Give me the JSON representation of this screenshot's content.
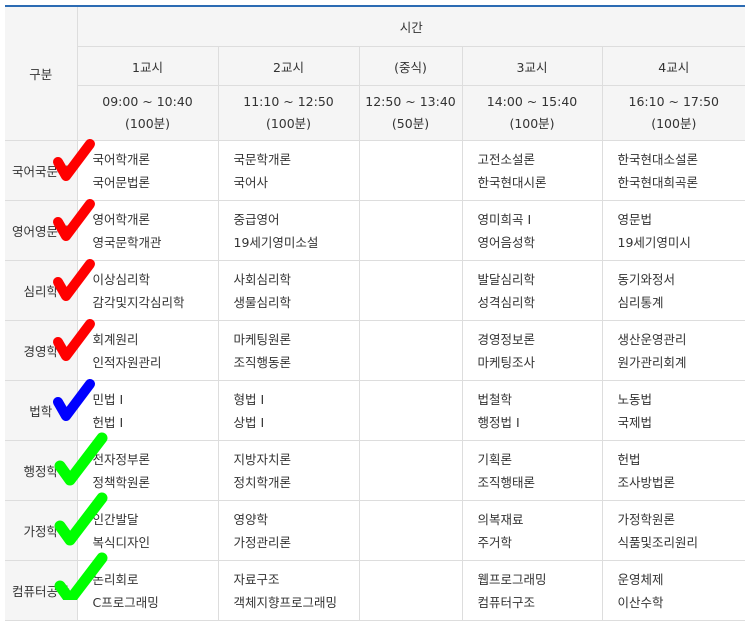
{
  "header": {
    "category_label": "구분",
    "time_label": "시간",
    "periods": [
      {
        "name": "1교시",
        "time": "09:00 ~ 10:40",
        "duration": "(100분)"
      },
      {
        "name": "2교시",
        "time": "11:10 ~ 12:50",
        "duration": "(100분)"
      },
      {
        "name": "(중식)",
        "time": "12:50 ~ 13:40",
        "duration": "(50분)"
      },
      {
        "name": "3교시",
        "time": "14:00 ~ 15:40",
        "duration": "(100분)"
      },
      {
        "name": "4교시",
        "time": "16:10 ~ 17:50",
        "duration": "(100분)"
      }
    ]
  },
  "rows": [
    {
      "major": "국어국문학",
      "p1": [
        "국어학개론",
        "국어문법론"
      ],
      "p2": [
        "국문학개론",
        "국어사"
      ],
      "p3": [
        "고전소설론",
        "한국현대시론"
      ],
      "p4": [
        "한국현대소설론",
        "한국현대희곡론"
      ]
    },
    {
      "major": "영어영문학",
      "p1": [
        "영어학개론",
        "영국문학개관"
      ],
      "p2": [
        "중급영어",
        "19세기영미소설"
      ],
      "p3": [
        "영미희곡 I",
        "영어음성학"
      ],
      "p4": [
        "영문법",
        "19세기영미시"
      ]
    },
    {
      "major": "심리학",
      "p1": [
        "이상심리학",
        "감각및지각심리학"
      ],
      "p2": [
        "사회심리학",
        "생물심리학"
      ],
      "p3": [
        "발달심리학",
        "성격심리학"
      ],
      "p4": [
        "동기와정서",
        "심리통계"
      ]
    },
    {
      "major": "경영학",
      "p1": [
        "회계원리",
        "인적자원관리"
      ],
      "p2": [
        "마케팅원론",
        "조직행동론"
      ],
      "p3": [
        "경영정보론",
        "마케팅조사"
      ],
      "p4": [
        "생산운영관리",
        "원가관리회계"
      ]
    },
    {
      "major": "법학",
      "p1": [
        "민법 I",
        "헌법 I"
      ],
      "p2": [
        "형법 I",
        "상법 I"
      ],
      "p3": [
        "법철학",
        "행정법 I"
      ],
      "p4": [
        "노동법",
        "국제법"
      ]
    },
    {
      "major": "행정학",
      "p1": [
        "전자정부론",
        "정책학원론"
      ],
      "p2": [
        "지방자치론",
        "정치학개론"
      ],
      "p3": [
        "기획론",
        "조직행태론"
      ],
      "p4": [
        "헌법",
        "조사방법론"
      ]
    },
    {
      "major": "가정학",
      "p1": [
        "인간발달",
        "복식디자인"
      ],
      "p2": [
        "영양학",
        "가정관리론"
      ],
      "p3": [
        "의복재료",
        "주거학"
      ],
      "p4": [
        "가정학원론",
        "식품및조리원리"
      ]
    },
    {
      "major": "컴퓨터공학",
      "p1": [
        "논리회로",
        "C프로그래밍"
      ],
      "p2": [
        "자료구조",
        "객체지향프로그래밍"
      ],
      "p3": [
        "웹프로그래밍",
        "컴퓨터구조"
      ],
      "p4": [
        "운영체제",
        "이산수학"
      ]
    }
  ],
  "annotations": {
    "marks": [
      {
        "icon": "checkmark-icon",
        "color": "#ff0000",
        "row": 0
      },
      {
        "icon": "checkmark-icon",
        "color": "#ff0000",
        "row": 1
      },
      {
        "icon": "checkmark-icon",
        "color": "#ff0000",
        "row": 2
      },
      {
        "icon": "checkmark-icon",
        "color": "#ff0000",
        "row": 3
      },
      {
        "icon": "checkmark-icon",
        "color": "#0000ff",
        "row": 4
      },
      {
        "icon": "checkmark-icon",
        "color": "#00ff00",
        "row": 5
      },
      {
        "icon": "checkmark-icon",
        "color": "#00ff00",
        "row": 6
      },
      {
        "icon": "checkmark-icon",
        "color": "#00ff00",
        "row": 7
      }
    ]
  },
  "colors": {
    "header_bg": "#f5f5f5",
    "top_border": "#2c6bb3",
    "grid": "#dddddd"
  }
}
